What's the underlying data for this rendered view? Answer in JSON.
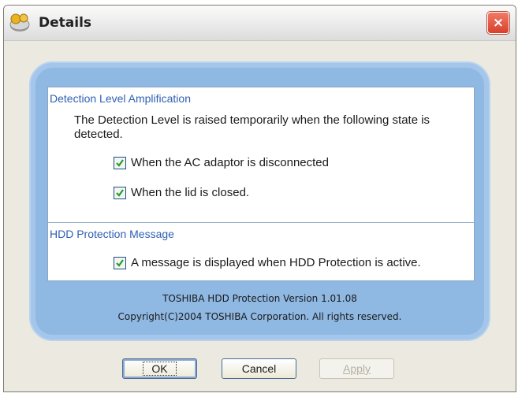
{
  "window": {
    "title": "Details",
    "close_label": "×"
  },
  "sections": [
    {
      "title": "Detection Level Amplification",
      "description": "The Detection Level is raised temporarily when the following state is detected.",
      "options": [
        {
          "label": "When the AC adaptor is disconnected",
          "checked": true
        },
        {
          "label": "When the lid is closed.",
          "checked": true
        }
      ]
    },
    {
      "title": "HDD Protection Message",
      "options": [
        {
          "label": "A message is displayed when HDD Protection is active.",
          "checked": true
        }
      ]
    }
  ],
  "footer": {
    "version": "TOSHIBA HDD Protection Version 1.01.08",
    "copyright": "Copyright(C)2004 TOSHIBA Corporation. All rights reserved."
  },
  "buttons": {
    "ok": "OK",
    "cancel": "Cancel",
    "apply": "Apply"
  }
}
